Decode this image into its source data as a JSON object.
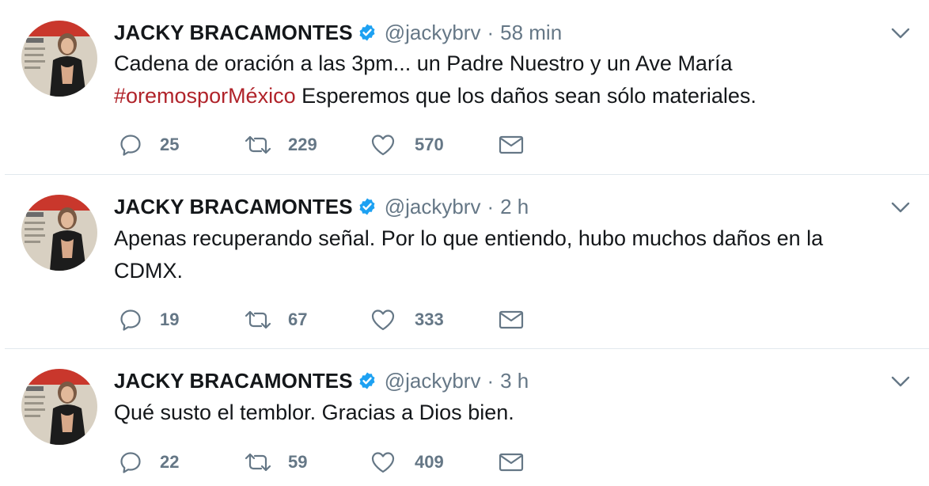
{
  "tweets": [
    {
      "name": "JACKY BRACAMONTES",
      "handle": "@jackybrv",
      "separator": "·",
      "time": "58 min",
      "text_line1": "Cadena de oración a las 3pm... un Padre Nuestro y un Ave María",
      "hashtag": "#oremosporMéxico",
      "text_line2_rest": " Esperemos que los daños sean sólo materiales.",
      "replies": "25",
      "retweets": "229",
      "likes": "570"
    },
    {
      "name": "JACKY BRACAMONTES",
      "handle": "@jackybrv",
      "separator": "·",
      "time": "2 h",
      "text_line1": "Apenas recuperando señal. Por lo que entiendo, hubo muchos daños en la",
      "text_line2": "CDMX.",
      "replies": "19",
      "retweets": "67",
      "likes": "333"
    },
    {
      "name": "JACKY BRACAMONTES",
      "handle": "@jackybrv",
      "separator": "·",
      "time": "3 h",
      "text_line1": "Qué susto el temblor. Gracias a Dios bien.",
      "replies": "22",
      "retweets": "59",
      "likes": "409"
    }
  ],
  "icons": {
    "verified": "verified-badge-icon",
    "caret": "chevron-down-icon",
    "reply": "reply-icon",
    "retweet": "retweet-icon",
    "like": "heart-icon",
    "message": "envelope-icon"
  },
  "colors": {
    "text": "#14171a",
    "muted": "#657786",
    "hashtag": "#b0232a",
    "verified": "#1da1f2",
    "divider": "#e1e8ed"
  }
}
